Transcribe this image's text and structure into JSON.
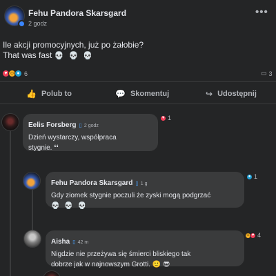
{
  "post": {
    "author": "Fehu Pandora Skarsgard",
    "time": "2 godz",
    "text_line1": "Ile akcji promocyjnych, już po żałobie?",
    "text_line2": "That was fast",
    "text_emoji": "💀 💀 💀",
    "more_label": "•••",
    "reactions": {
      "icons": [
        "heart",
        "haha",
        "care"
      ],
      "count": "6"
    },
    "comments_count": "3",
    "actions": {
      "like": "Polub to",
      "comment": "Skomentuj",
      "share": "Udostępnij"
    }
  },
  "comments": [
    {
      "author": "Eelis Forsberg",
      "badge": "▯",
      "time": "2 godz",
      "line1": "Dzień wystarczy, współpraca",
      "line2": "stygnie. ❛❛",
      "reactions": {
        "icons": [
          "heart"
        ],
        "count": "1"
      }
    },
    {
      "author": "Fehu Pandora Skarsgard",
      "badge": "▯",
      "time": "1 g",
      "line1": "Gdy ziomek stygnie poczuli że zyski mogą podgrzać",
      "line2": "💀 💀 💀",
      "reactions": {
        "icons": [
          "care"
        ],
        "count": "1"
      }
    },
    {
      "author": "Aisha",
      "badge": "▯",
      "time": "42 m",
      "line1": "Nigdzie nie przeżywa się śmierci bliskiego tak",
      "line2": "dobrze jak w najnowszym Grotti. 🙂 😎",
      "reactions": {
        "icons": [
          "haha",
          "heart"
        ],
        "count": "4"
      }
    }
  ],
  "colors": {
    "background": "#242526",
    "bubble": "#3a3b3c",
    "text": "#e4e6eb",
    "muted": "#b0b3b8",
    "accent": "#3a86ff"
  }
}
